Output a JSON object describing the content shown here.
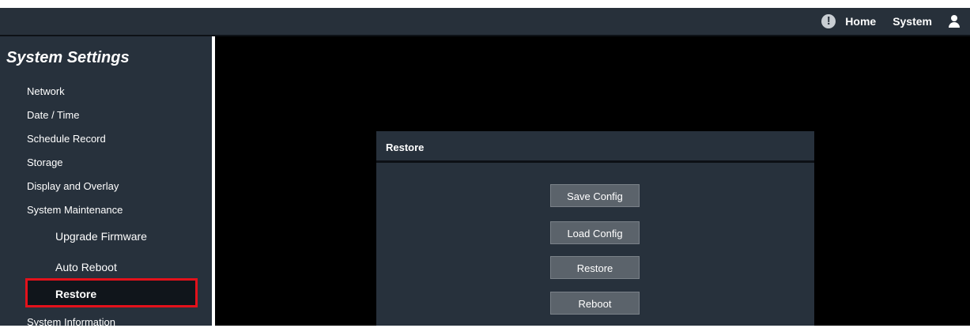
{
  "topbar": {
    "alert_icon": "!",
    "home_label": "Home",
    "system_label": "System",
    "user_icon": "user-icon"
  },
  "sidebar": {
    "title": "System Settings",
    "items": [
      {
        "label": "Network"
      },
      {
        "label": "Date / Time"
      },
      {
        "label": "Schedule Record"
      },
      {
        "label": "Storage"
      },
      {
        "label": "Display and Overlay"
      },
      {
        "label": "System Maintenance"
      },
      {
        "label": "Upgrade Firmware"
      },
      {
        "label": "Auto Reboot"
      },
      {
        "label": "Restore"
      },
      {
        "label": "System Information"
      }
    ],
    "active_item": "Restore",
    "highlight_color": "#e3111b"
  },
  "panel": {
    "title": "Restore",
    "buttons": [
      {
        "label": "Save Config"
      },
      {
        "label": "Load Config"
      },
      {
        "label": "Restore"
      },
      {
        "label": "Reboot"
      }
    ]
  }
}
